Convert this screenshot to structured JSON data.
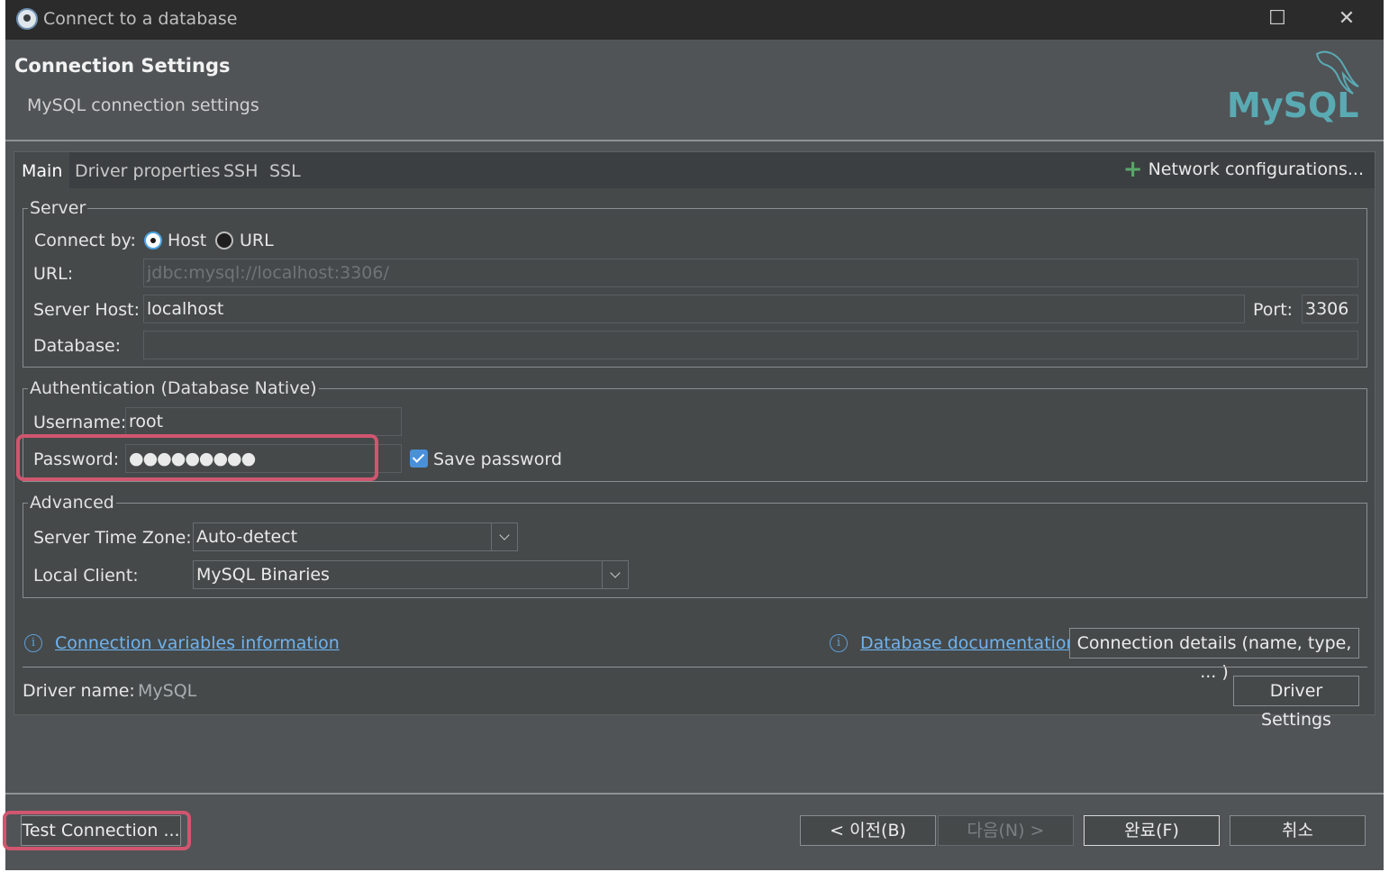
{
  "window": {
    "title": "Connect to a database",
    "maximize_glyph": "☐",
    "close_glyph": "✕"
  },
  "header": {
    "title": "Connection Settings",
    "subtitle": "MySQL connection settings",
    "logo_text": "MySQL",
    "logo_color": "#5aaab3",
    "logo_accent": "#e0a126"
  },
  "tabs": [
    {
      "label": "Main",
      "active": true
    },
    {
      "label": "Driver properties"
    },
    {
      "label": "SSH"
    },
    {
      "label": "SSL"
    }
  ],
  "network_config": {
    "icon": "plus-icon",
    "label": "Network configurations..."
  },
  "server": {
    "legend": "Server",
    "connect_by_label": "Connect by:",
    "host_option": "Host",
    "url_option": "URL",
    "selected": "Host",
    "url_label": "URL:",
    "url_value": "jdbc:mysql://localhost:3306/",
    "host_label": "Server Host:",
    "host_value": "localhost",
    "port_label": "Port:",
    "port_value": "3306",
    "database_label": "Database:",
    "database_value": ""
  },
  "auth": {
    "legend": "Authentication (Database Native)",
    "username_label": "Username:",
    "username_value": "root",
    "password_label": "Password:",
    "password_value": "●●●●●●●●●",
    "save_password_label": "Save password",
    "save_password_checked": true
  },
  "advanced": {
    "legend": "Advanced",
    "timezone_label": "Server Time Zone:",
    "timezone_value": "Auto-detect",
    "client_label": "Local Client:",
    "client_value": "MySQL Binaries"
  },
  "links": {
    "variables_info": "Connection variables information",
    "db_docs": "Database documentation",
    "details_button": "Connection details (name, type, ... )"
  },
  "driver": {
    "label": "Driver name:",
    "value": "MySQL",
    "settings_button": "Driver Settings"
  },
  "footer": {
    "test_connection": "Test Connection ...",
    "back": "< 이전(B)",
    "next": "다음(N) >",
    "finish": "완료(F)",
    "cancel": "취소"
  },
  "colors": {
    "highlight": "#d0566f",
    "link": "#6fb3ef",
    "checkbox": "#4a90d9"
  }
}
